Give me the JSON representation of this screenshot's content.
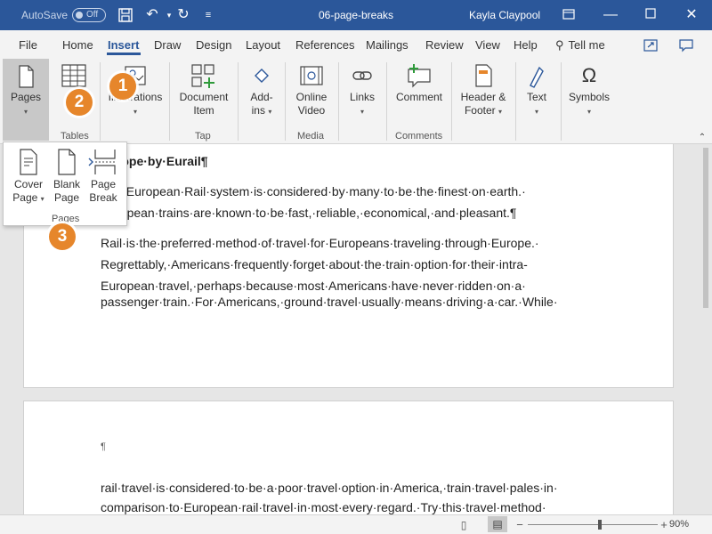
{
  "titlebar": {
    "autosave_label": "AutoSave",
    "autosave_state": "Off",
    "document_title": "06-page-breaks",
    "user_name": "Kayla Claypool"
  },
  "tabs": [
    "File",
    "Home",
    "Insert",
    "Draw",
    "Design",
    "Layout",
    "References",
    "Mailings",
    "Review",
    "View",
    "Help"
  ],
  "active_tab": "Insert",
  "tell_me": "Tell me",
  "ribbon": {
    "pages": {
      "label": "Pages"
    },
    "tables": {
      "group": "Tables"
    },
    "illustrations": {
      "label": "Illustrations"
    },
    "tap": {
      "label_line1": "Document",
      "label_line2": "Item",
      "group": "Tap"
    },
    "addins": {
      "label_line1": "Add-",
      "label_line2": "ins"
    },
    "media": {
      "label_line1": "Online",
      "label_line2": "Video",
      "group": "Media"
    },
    "links": {
      "label": "Links"
    },
    "comments": {
      "label": "Comment",
      "group": "Comments"
    },
    "header_footer": {
      "label_line1": "Header &",
      "label_line2": "Footer"
    },
    "text": {
      "label": "Text"
    },
    "symbols": {
      "label": "Symbols"
    }
  },
  "pages_dropdown": {
    "cover_page": {
      "line1": "Cover",
      "line2": "Page"
    },
    "blank_page": {
      "line1": "Blank",
      "line2": "Page"
    },
    "page_break": {
      "line1": "Page",
      "line2": "Break"
    },
    "group_label": "Pages"
  },
  "callouts": [
    "1",
    "2",
    "3"
  ],
  "document": {
    "page1": {
      "heading": "Europe·by·Eurail¶",
      "para1_line1": "The·European·Rail·system·is·considered·by·many·to·be·the·finest·on·earth.·",
      "para1_line2": "European·trains·are·known·to·be·fast,·reliable,·economical,·and·pleasant.¶",
      "para2_line1": "Rail·is·the·preferred·method·of·travel·for·Europeans·traveling·through·Europe.·",
      "para2_line2": "Regrettably,·Americans·frequently·forget·about·the·train·option·for·their·intra-",
      "para2_line3": "European·travel,·perhaps·because·most·Americans·have·never·ridden·on·a·",
      "para2_line4": "passenger·train.·For·Americans,·ground·travel·usually·means·driving·a·car.·While·"
    },
    "page2": {
      "pilcrow": "¶",
      "para_line1": "rail·travel·is·considered·to·be·a·poor·travel·option·in·America,·train·travel·pales·in·",
      "para_line2": "comparison·to·European·rail·travel·in·most·every·regard.·Try·this·travel·method·"
    }
  },
  "statusbar": {
    "zoom": "90%"
  },
  "colors": {
    "accent": "#2b579a",
    "callout": "#e6862b"
  }
}
